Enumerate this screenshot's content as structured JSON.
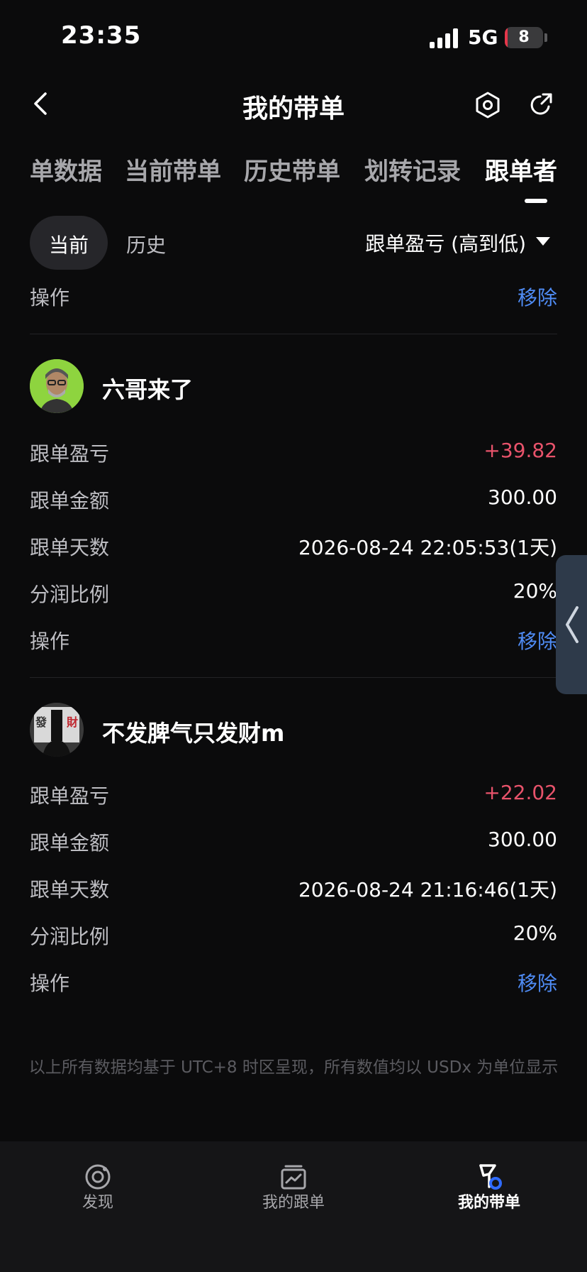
{
  "status_bar": {
    "time": "23:35",
    "network": "5G",
    "battery": "8",
    "battery_percent": 8
  },
  "nav": {
    "title": "我的带单"
  },
  "tabs": [
    {
      "label": "单数据",
      "active": false
    },
    {
      "label": "当前带单",
      "active": false
    },
    {
      "label": "历史带单",
      "active": false
    },
    {
      "label": "划转记录",
      "active": false
    },
    {
      "label": "跟单者",
      "active": true
    }
  ],
  "segment": {
    "current": "当前",
    "history": "历史",
    "sort_label": "跟单盈亏 (高到低)"
  },
  "partial_row": {
    "label": "操作",
    "action": "移除"
  },
  "followers": [
    {
      "name": "六哥来了",
      "avatar_icon": "profile-photo",
      "rows": [
        {
          "label": "跟单盈亏",
          "value": "+39.82"
        },
        {
          "label": "跟单金额",
          "value": "300.00"
        },
        {
          "label": "跟单天数",
          "value": "2026-08-24 22:05:53(1天)"
        },
        {
          "label": "分润比例",
          "value": "20%"
        }
      ],
      "action_label": "操作",
      "action": "移除"
    },
    {
      "name": "不发脾气只发财m",
      "avatar_icon": "profile-photo",
      "avatar_chars": [
        "發",
        "財"
      ],
      "rows": [
        {
          "label": "跟单盈亏",
          "value": "+22.02"
        },
        {
          "label": "跟单金额",
          "value": "300.00"
        },
        {
          "label": "跟单天数",
          "value": "2026-08-24 21:16:46(1天)"
        },
        {
          "label": "分润比例",
          "value": "20%"
        }
      ],
      "action_label": "操作",
      "action": "移除"
    }
  ],
  "footer_note": "以上所有数据均基于 UTC+8 时区呈现，所有数值均以 USDx 为单位显示",
  "bottom_nav": [
    {
      "label": "发现",
      "icon": "discover-icon",
      "active": false
    },
    {
      "label": "我的跟单",
      "icon": "copy-trade-icon",
      "active": false
    },
    {
      "label": "我的带单",
      "icon": "lead-trade-icon",
      "active": true
    }
  ],
  "colors": {
    "positive": "#e8536b",
    "link": "#4f8cf5",
    "background": "#0b0b0c"
  }
}
